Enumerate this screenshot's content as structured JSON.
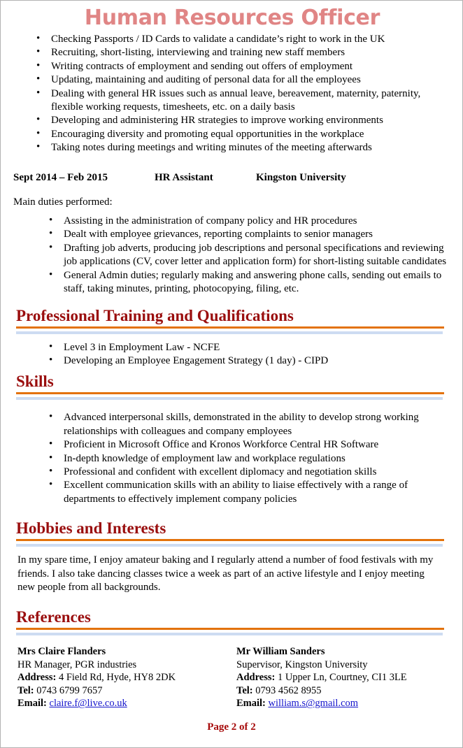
{
  "document": {
    "title": "Human Resources Officer",
    "footer": "Page 2 of 2"
  },
  "role_duties": [
    "Checking Passports / ID Cards to validate a candidate’s right to work in the UK",
    "Recruiting, short-listing, interviewing and training new staff members",
    "Writing contracts of employment and sending out offers of employment",
    "Updating, maintaining and auditing of personal data for all the employees",
    "Dealing with general HR issues such as annual leave, bereavement, maternity, paternity, flexible working requests, timesheets, etc. on a daily basis",
    "Developing and administering HR strategies to improve working environments",
    "Encouraging diversity and promoting equal opportunities in the workplace",
    "Taking notes during meetings and writing minutes of the meeting afterwards"
  ],
  "previous_job": {
    "dates": "Sept 2014 – Feb 2015",
    "role": "HR Assistant",
    "organisation": "Kingston University",
    "duties_label": "Main duties performed:",
    "duties": [
      "Assisting in the administration of company policy and HR procedures",
      "Dealt with employee grievances, reporting complaints to senior managers",
      "Drafting job adverts, producing job descriptions and personal specifications and reviewing job applications (CV, cover letter and application form) for short-listing suitable candidates",
      "General Admin duties; regularly making and answering phone calls, sending out emails to staff, taking minutes, printing, photocopying, filing, etc."
    ]
  },
  "training": {
    "heading": "Professional Training and Qualifications",
    "items": [
      "Level 3 in Employment Law - NCFE",
      "Developing an Employee Engagement Strategy (1 day) - CIPD"
    ]
  },
  "skills": {
    "heading": "Skills",
    "items": [
      "Advanced interpersonal skills, demonstrated in the ability to develop strong working relationships with colleagues and company employees",
      "Proficient in Microsoft Office and Kronos Workforce Central HR Software",
      "In-depth knowledge of employment law and workplace regulations",
      "Professional and confident with excellent diplomacy and negotiation skills",
      "Excellent communication skills with an ability to liaise effectively with a range of departments to effectively implement company policies"
    ]
  },
  "hobbies": {
    "heading": "Hobbies and Interests",
    "text": "In my spare time, I enjoy amateur baking and I regularly attend a number of food festivals with my friends. I also take dancing classes twice a week as part of an active lifestyle and I enjoy meeting new people from all backgrounds."
  },
  "references": {
    "heading": "References",
    "labels": {
      "address": "Address:",
      "tel": "Tel:",
      "email": "Email:"
    },
    "entries": [
      {
        "name": "Mrs Claire Flanders",
        "position": "HR Manager, PGR industries",
        "address": "4 Field Rd, Hyde, HY8 2DK",
        "tel": "0743 6799 7657",
        "email": "claire.f@live.co.uk"
      },
      {
        "name": "Mr William Sanders",
        "position": "Supervisor, Kingston University",
        "address": "1 Upper Ln, Courtney, CI1 3LE",
        "tel": "0793 4562 8955",
        "email": "william.s@gmail.com"
      }
    ]
  },
  "colors": {
    "title": "#E08585",
    "section_heading": "#9A0E0E",
    "rule_orange": "#E3720B",
    "rule_blue": "#CDDCF2",
    "link": "#1515CC",
    "footer": "#A60A0A"
  }
}
